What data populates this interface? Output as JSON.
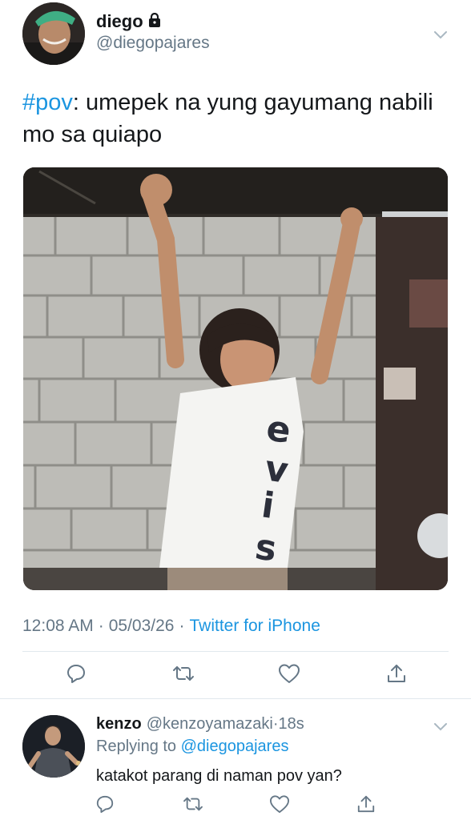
{
  "tweet": {
    "author_name": "diego",
    "author_handle": "@diegopajares",
    "hashtag": "#pov",
    "text_after_hashtag": ": umepek na yung gayumang nabili mo sa quiapo",
    "time": "12:08 AM",
    "date": "05/03/26",
    "source": "Twitter for iPhone",
    "separator": "·"
  },
  "reply": {
    "author_name": "kenzo",
    "author_handle": "@kenzoyamazaki",
    "time_ago": "18s",
    "separator": "·",
    "replying_label": "Replying to",
    "replying_handle": "@diegopajares",
    "text": "katakot parang di naman pov yan?"
  },
  "icons": {
    "lock": "lock-icon",
    "chevron": "chevron-down-icon",
    "reply": "reply-icon",
    "retweet": "retweet-icon",
    "like": "like-icon",
    "share": "share-icon"
  },
  "colors": {
    "link": "#1b95e0",
    "secondary_text": "#657786",
    "primary_text": "#14171a",
    "divider": "#e1e8ed"
  }
}
